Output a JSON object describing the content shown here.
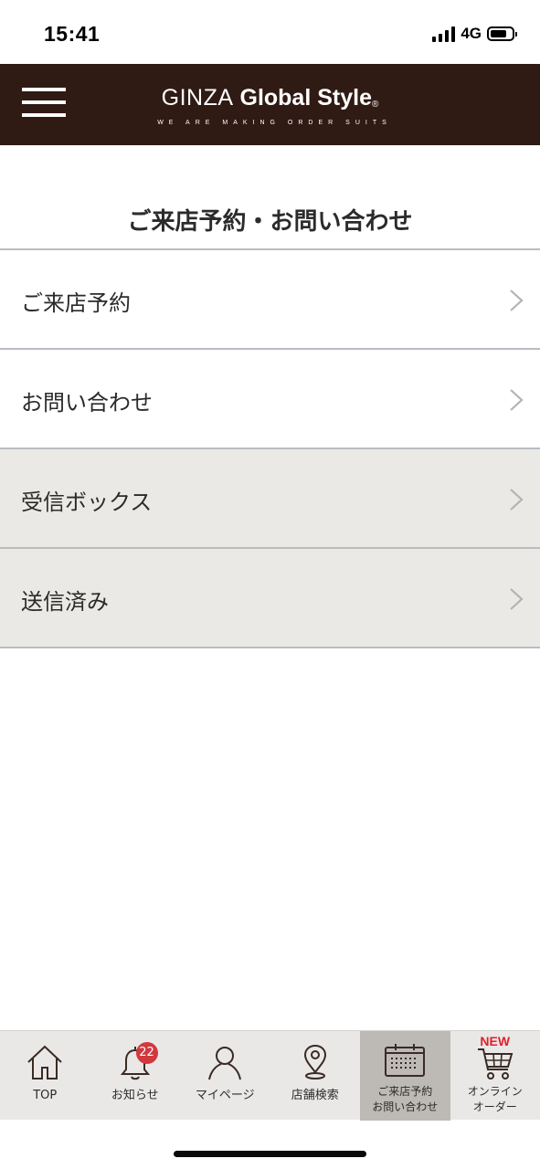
{
  "status_bar": {
    "time": "15:41",
    "network": "4G"
  },
  "header": {
    "brand_light": "GINZA",
    "brand_bold": "Global Style",
    "brand_mark": "®",
    "tagline": "WE ARE MAKING ORDER SUITS",
    "menu_icon": "hamburger-icon",
    "background_color": "#2f1a14"
  },
  "page": {
    "title": "ご来店予約・お問い合わせ"
  },
  "menu": {
    "items": [
      {
        "label": "ご来店予約",
        "style": "white"
      },
      {
        "label": "お問い合わせ",
        "style": "white"
      },
      {
        "label": "受信ボックス",
        "style": "gray"
      },
      {
        "label": "送信済み",
        "style": "gray"
      }
    ],
    "chevron_icon": "chevron-right-icon"
  },
  "tab_bar": {
    "tabs": [
      {
        "label": "TOP",
        "icon": "home-icon"
      },
      {
        "label": "お知らせ",
        "icon": "bell-icon",
        "badge": "22"
      },
      {
        "label": "マイページ",
        "icon": "user-icon"
      },
      {
        "label": "店舗検索",
        "icon": "map-pin-icon"
      },
      {
        "label_line1": "ご来店予約",
        "label_line2": "お問い合わせ",
        "icon": "calendar-icon",
        "active": true
      },
      {
        "label_line1": "オンライン",
        "label_line2": "オーダー",
        "icon": "cart-icon",
        "flag": "NEW"
      }
    ]
  },
  "colors": {
    "active_tab": "#bdbab5",
    "tab_bar_bg": "#e9e8e6",
    "badge": "#d0393e",
    "new_flag": "#e2202b",
    "gray_row": "#ebe9e5"
  }
}
